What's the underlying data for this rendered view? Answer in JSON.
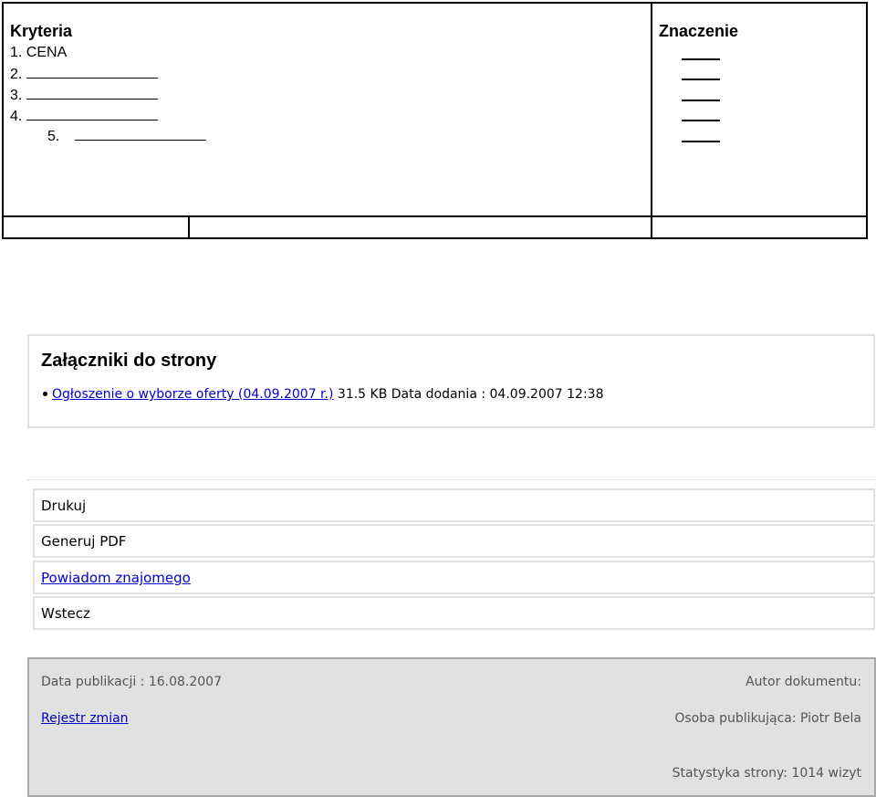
{
  "criteria": {
    "header_left": "Kryteria",
    "header_right": "Znaczenie",
    "items": [
      {
        "num": "1.",
        "text": "CENA"
      },
      {
        "num": "2.",
        "text": ""
      },
      {
        "num": "3.",
        "text": ""
      },
      {
        "num": "4.",
        "text": ""
      },
      {
        "num": "5.",
        "text": ""
      }
    ]
  },
  "attachments": {
    "title": "Załączniki do strony",
    "link": "Ogłoszenie o wyborze oferty (04.09.2007 r.)",
    "meta": "31.5 KB Data dodania : 04.09.2007 12:38"
  },
  "actions": {
    "print": "Drukuj",
    "pdf": "Generuj PDF",
    "notify": "Powiadom znajomego",
    "back": "Wstecz"
  },
  "footer": {
    "published": "Data publikacji : 16.08.2007",
    "changelog": "Rejestr zmian",
    "author": "Autor dokumentu:",
    "publisher": "Osoba publikująca: Piotr Bela",
    "stats": "Statystyka strony: 1014 wizyt"
  }
}
